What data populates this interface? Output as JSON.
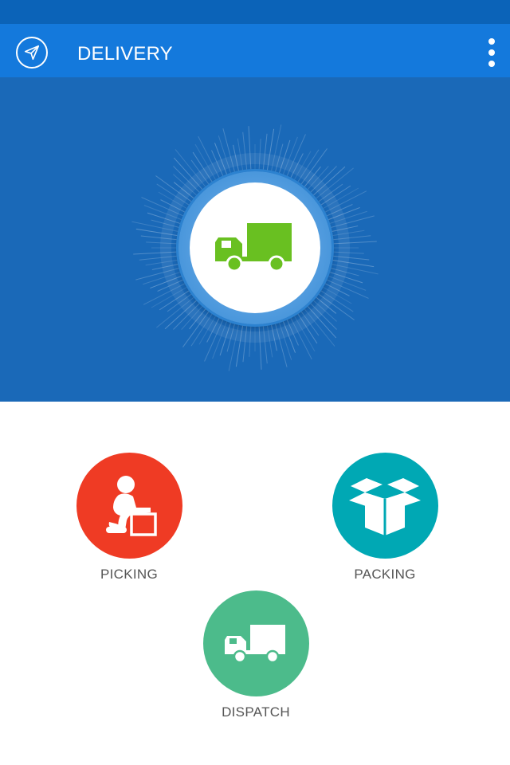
{
  "app_bar": {
    "title": "DELIVERY",
    "nav_icon": "navigation-arrow-icon",
    "menu_icon": "more-vertical-icon"
  },
  "hero": {
    "icon": "delivery-truck-icon",
    "icon_color": "#69c021"
  },
  "actions": [
    {
      "label": "PICKING",
      "icon": "person-lifting-box-icon",
      "color": "#ef3b24"
    },
    {
      "label": "PACKING",
      "icon": "open-box-icon",
      "color": "#00a8b4"
    },
    {
      "label": "DISPATCH",
      "icon": "delivery-truck-icon",
      "color": "#4cbb8b"
    }
  ],
  "colors": {
    "status_bar": "#0b63b8",
    "app_bar": "#1479dc",
    "hero_background": "#1a69b8",
    "label_text": "#555555"
  }
}
